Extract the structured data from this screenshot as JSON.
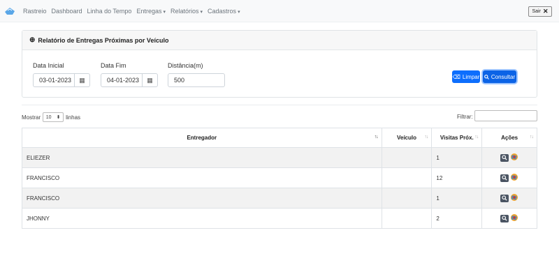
{
  "nav": {
    "items": [
      {
        "label": "Rastreio",
        "dropdown": false
      },
      {
        "label": "Dashboard",
        "dropdown": false
      },
      {
        "label": "Linha do Tempo",
        "dropdown": false
      },
      {
        "label": "Entregas",
        "dropdown": true
      },
      {
        "label": "Relatórios",
        "dropdown": true
      },
      {
        "label": "Cadastros",
        "dropdown": true
      }
    ],
    "logout_label": "Sair"
  },
  "card": {
    "title": "Relatório de Entregas Próximas por Veículo",
    "data_inicial_label": "Data Inicial",
    "data_inicial_value": "03-01-2023",
    "data_fim_label": "Data Fim",
    "data_fim_value": "04-01-2023",
    "distancia_label": "Distância(m)",
    "distancia_value": "500",
    "limpar_label": "Limpar",
    "consultar_label": "Consultar"
  },
  "table_controls": {
    "mostrar_label": "Mostrar",
    "page_size": "10",
    "linhas_label": "linhas",
    "filtrar_label": "Filtrar:"
  },
  "table": {
    "headers": [
      "Entregador",
      "Veículo",
      "Visitas Próx.",
      "Ações"
    ],
    "rows": [
      {
        "entregador": "ELIEZER",
        "veiculo": "",
        "visitas": "1"
      },
      {
        "entregador": "FRANCISCO",
        "veiculo": "",
        "visitas": "12"
      },
      {
        "entregador": "FRANCISCO",
        "veiculo": "",
        "visitas": "1"
      },
      {
        "entregador": "JHONNY",
        "veiculo": "",
        "visitas": "2"
      }
    ]
  }
}
